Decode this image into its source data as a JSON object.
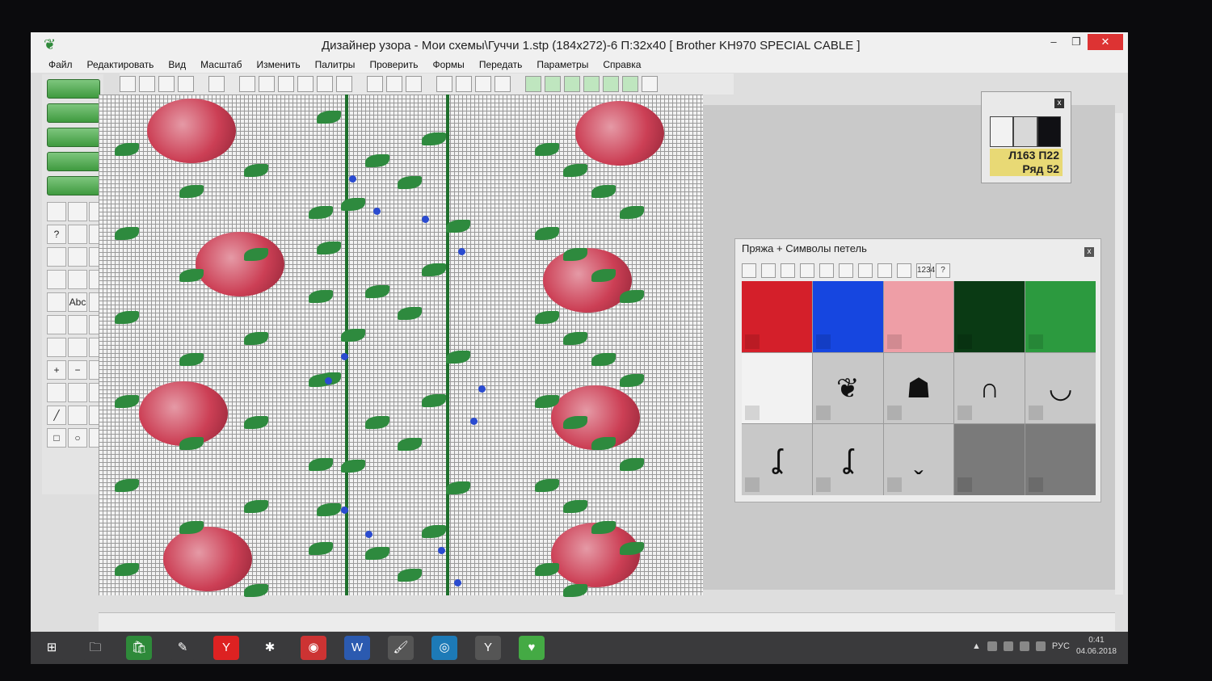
{
  "window": {
    "title": "Дизайнер узора - Мои схемы\\Гуччи 1.stp (184x272)-6      П:32x40     [ Brother KH970 SPECIAL CABLE ]",
    "controls": {
      "minimize": "–",
      "maximize": "❐",
      "close": "✕"
    }
  },
  "menu": [
    "Файл",
    "Редактировать",
    "Вид",
    "Масштаб",
    "Изменить",
    "Палитры",
    "Проверить",
    "Формы",
    "Передать",
    "Параметры",
    "Справка"
  ],
  "toolbar_icons": [
    "zoom-in-icon",
    "zoom-out-icon",
    "zoom-fit-icon",
    "zoom-select-icon",
    "sep",
    "page-icon",
    "sep",
    "h-line-icon",
    "v-line-icon",
    "grid-icon",
    "pattern-icon",
    "pencil-icon",
    "numbers-icon",
    "sep",
    "palette-icon",
    "grid2-icon",
    "cross-icon",
    "sep",
    "select-icon",
    "rect-select-icon",
    "move-select-icon",
    "frame-select-icon",
    "sep",
    "flip-h-icon",
    "flip-v-icon",
    "rotate-icon",
    "dup-icon",
    "copy-icon",
    "knit-icon",
    "check-icon"
  ],
  "left_panel": {
    "big_buttons": [
      "sweater-icon",
      "chart-icon",
      "heart-pattern-icon",
      "cable-icon",
      "screen-icon"
    ],
    "tools": [
      "open-icon",
      "save-icon",
      "print-icon",
      "help-icon",
      "undo-icon",
      "redo-icon",
      "cut-icon",
      "stamp-icon",
      "paste-icon",
      "table1-icon",
      "table2-icon",
      "table3-icon",
      "brush-fill-icon",
      "Abc",
      "shuffle-icon",
      "checker-icon",
      "checker2-icon",
      "dot-icon",
      "move-icon",
      "blank-icon",
      "mirror-icon",
      "plus-icon",
      "minus-icon",
      "spiral-icon",
      "pencil-tool-icon",
      "paint-icon",
      "fill-icon",
      "line-icon",
      "blank2-icon",
      "select-paint-icon",
      "rect-icon",
      "circle-icon",
      "eyedropper-icon"
    ],
    "tool_glyphs": {
      "Abc": "Abc",
      "plus-icon": "+",
      "minus-icon": "−",
      "rect-icon": "□",
      "circle-icon": "○",
      "line-icon": "╱",
      "help-icon": "?"
    }
  },
  "indicator": {
    "close": "x",
    "line1": "Л163 П22",
    "line2": "Ряд 52",
    "swatches": [
      "#f2f2f2",
      "#d8d8d8",
      "#101014"
    ]
  },
  "yarn_panel": {
    "title": "Пряжа + Символы петель",
    "close": "x",
    "tools": [
      "palette1-icon",
      "palette2-icon",
      "down-icon",
      "next-icon",
      "swap-icon",
      "folder-icon",
      "sort-icon",
      "grid-a-icon",
      "grid-b-icon",
      "1234",
      "help"
    ],
    "tool_glyphs": {
      "1234": "1234",
      "help": "?"
    },
    "cells": [
      {
        "color": "#d41f2a"
      },
      {
        "color": "#1646e0"
      },
      {
        "color": "#ee9ea6"
      },
      {
        "color": "#0a3a14"
      },
      {
        "color": "#2c9a3f"
      },
      {
        "color": "#f2f2f2",
        "symbol": ""
      },
      {
        "color": "#c8c8c8",
        "symbol": "❦"
      },
      {
        "color": "#c8c8c8",
        "symbol": "☗"
      },
      {
        "color": "#c8c8c8",
        "symbol": "∩"
      },
      {
        "color": "#c8c8c8",
        "symbol": "◡"
      },
      {
        "color": "#c8c8c8",
        "symbol": "ʆ"
      },
      {
        "color": "#c8c8c8",
        "symbol": "ʆ"
      },
      {
        "color": "#c8c8c8",
        "symbol": "ˬ"
      },
      {
        "color": "#7a7a7a",
        "symbol": ""
      },
      {
        "color": "#7a7a7a",
        "symbol": ""
      }
    ]
  },
  "taskbar": {
    "apps": [
      {
        "name": "start-icon",
        "glyph": "⊞",
        "bg": "#3a3a3c"
      },
      {
        "name": "explorer-icon",
        "glyph": "🗀",
        "bg": "#3a3a3c"
      },
      {
        "name": "store-icon",
        "glyph": "🛍",
        "bg": "#2e8a3a"
      },
      {
        "name": "notepad-icon",
        "glyph": "✎",
        "bg": "#3a3a3c"
      },
      {
        "name": "yandex-icon",
        "glyph": "Y",
        "bg": "#d22"
      },
      {
        "name": "paint-icon",
        "glyph": "✱",
        "bg": "#3a3a3c"
      },
      {
        "name": "chrome-icon",
        "glyph": "◉",
        "bg": "#c33"
      },
      {
        "name": "word-icon",
        "glyph": "W",
        "bg": "#2b5ab0"
      },
      {
        "name": "brush-icon",
        "glyph": "🖌",
        "bg": "#555"
      },
      {
        "name": "disc-icon",
        "glyph": "◎",
        "bg": "#1d7ab7"
      },
      {
        "name": "yandex2-icon",
        "glyph": "Y",
        "bg": "#555"
      },
      {
        "name": "designaknit-icon",
        "glyph": "♥",
        "bg": "#4a4"
      }
    ],
    "lang": "РУС",
    "time": "0:41",
    "date": "04.06.2018"
  }
}
